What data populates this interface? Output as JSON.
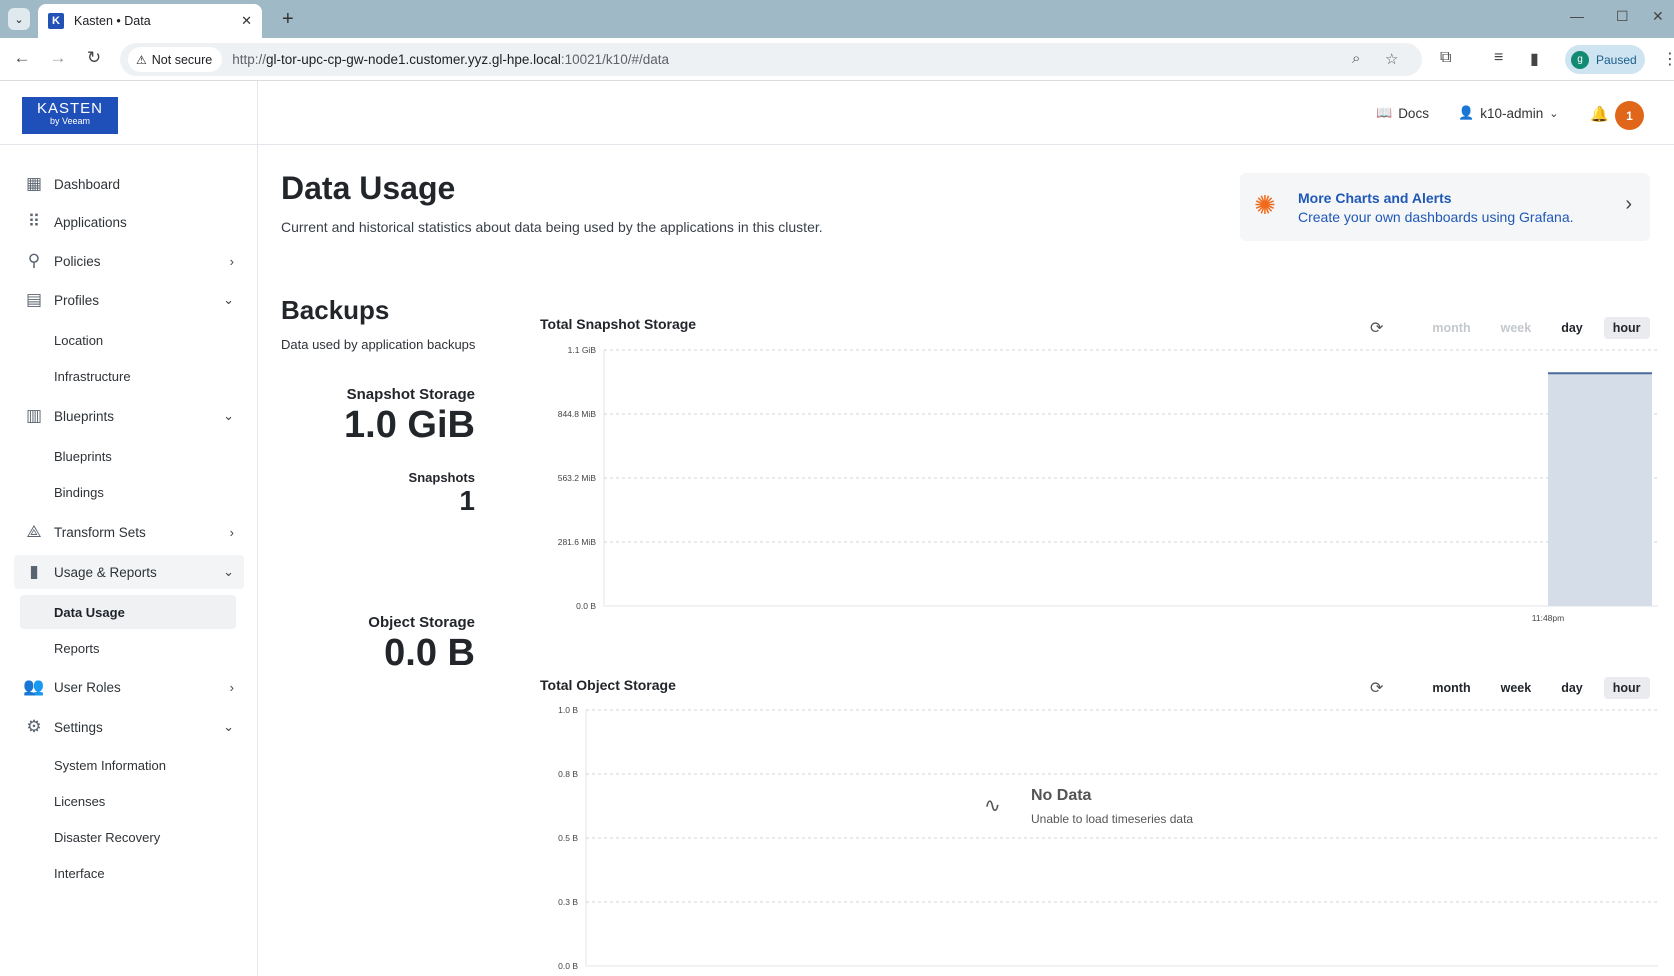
{
  "browser": {
    "tab_title": "Kasten • Data",
    "tab_favicon": "K",
    "security_label": "Not secure",
    "url_prefix": "http://",
    "url_host": "gl-tor-upc-cp-gw-node1.customer.yyz.gl-hpe.local",
    "url_path": ":10021/k10/#/data",
    "profile_initial": "g",
    "profile_status": "Paused"
  },
  "header": {
    "logo_line1": "KASTEN",
    "logo_line2": "by Veeam",
    "docs_label": "Docs",
    "user_label": "k10-admin",
    "notification_count": "1"
  },
  "sidebar": {
    "items": [
      {
        "label": "Dashboard",
        "icon": "dashboard-icon"
      },
      {
        "label": "Applications",
        "icon": "apps-grid-icon"
      },
      {
        "label": "Policies",
        "icon": "policies-icon"
      },
      {
        "label": "Profiles",
        "icon": "profiles-icon"
      },
      {
        "label": "Blueprints",
        "icon": "blueprints-map-icon"
      },
      {
        "label": "Transform Sets",
        "icon": "transform-icon"
      },
      {
        "label": "Usage & Reports",
        "icon": "bar-chart-icon"
      },
      {
        "label": "User Roles",
        "icon": "users-icon"
      },
      {
        "label": "Settings",
        "icon": "gear-icon"
      }
    ],
    "profiles_sub": [
      "Location",
      "Infrastructure"
    ],
    "blueprints_sub": [
      "Blueprints",
      "Bindings"
    ],
    "usage_sub": [
      "Data Usage",
      "Reports"
    ],
    "settings_sub": [
      "System Information",
      "Licenses",
      "Disaster Recovery",
      "Interface"
    ]
  },
  "page": {
    "title": "Data Usage",
    "subtitle": "Current and historical statistics about data being used by the applications in this cluster.",
    "grafana_title": "More Charts and Alerts",
    "grafana_sub": "Create your own dashboards using Grafana."
  },
  "backups": {
    "title": "Backups",
    "subtitle": "Data used by application backups",
    "snapshot_storage_label": "Snapshot Storage",
    "snapshot_storage_value": "1.0 GiB",
    "snapshots_label": "Snapshots",
    "snapshots_value": "1",
    "object_storage_label": "Object Storage",
    "object_storage_value": "0.0 B"
  },
  "range_labels": {
    "month": "month",
    "week": "week",
    "day": "day",
    "hour": "hour"
  },
  "chart_data": [
    {
      "type": "area",
      "title": "Total Snapshot Storage",
      "y_ticks": [
        "0.0 B",
        "281.6 MiB",
        "563.2 MiB",
        "844.8 MiB",
        "1.1 GiB"
      ],
      "x_ticks": [
        "11:48pm"
      ],
      "series": [
        {
          "x": [
            "11:48pm"
          ],
          "values": [
            1.0
          ]
        }
      ],
      "y_unit": "GiB",
      "ylim": [
        0,
        1.1
      ],
      "selected_range": "hour",
      "grid": true,
      "color": "#d5dde9",
      "line_color": "#4a6a9a"
    },
    {
      "type": "area",
      "title": "Total Object Storage",
      "y_ticks": [
        "0.0 B",
        "0.3 B",
        "0.5 B",
        "0.8 B",
        "1.0 B"
      ],
      "x_ticks": [],
      "series": [],
      "ylim": [
        0,
        1.0
      ],
      "selected_range": "hour",
      "grid": true,
      "no_data_title": "No Data",
      "no_data_sub": "Unable to load timeseries data"
    }
  ]
}
